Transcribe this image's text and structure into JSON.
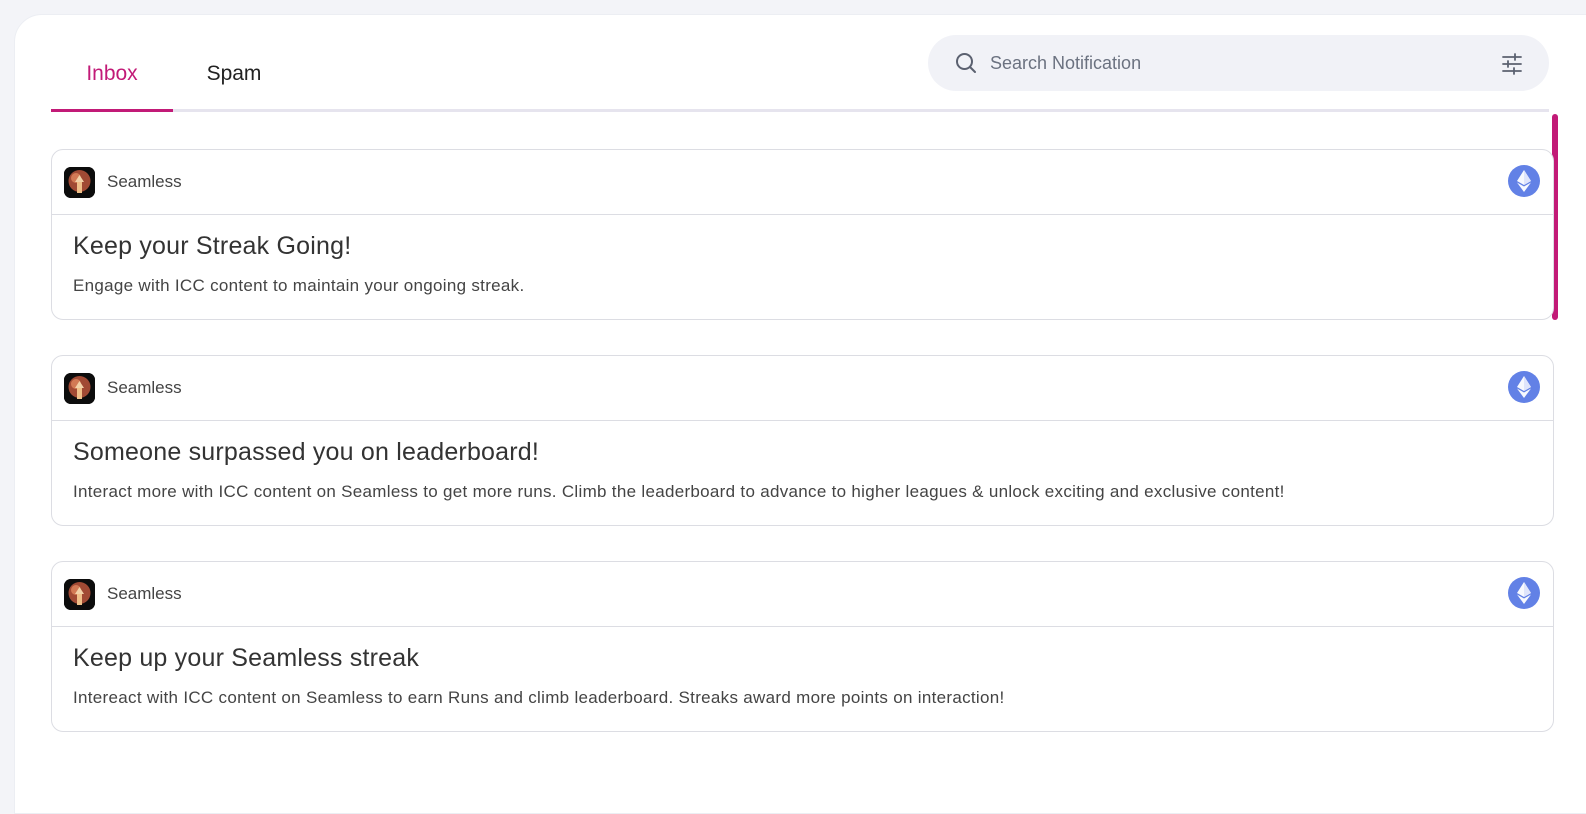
{
  "tabs": [
    {
      "label": "Inbox",
      "active": true
    },
    {
      "label": "Spam",
      "active": false
    }
  ],
  "search": {
    "placeholder": "Search Notification",
    "icon": "search-icon",
    "filter_icon": "filter-sliders-icon"
  },
  "colors": {
    "accent": "#c21a77",
    "chain": "#6281e6"
  },
  "notifications": [
    {
      "source": "Seamless",
      "title": "Keep your Streak Going!",
      "body": "Engage with ICC content to maintain your ongoing streak.",
      "chain_icon": "ethereum-icon"
    },
    {
      "source": "Seamless",
      "title": "Someone surpassed you on leaderboard!",
      "body": "Interact more with ICC content on Seamless to get more runs. Climb the leaderboard to advance to higher leagues & unlock exciting and exclusive content!",
      "chain_icon": "ethereum-icon"
    },
    {
      "source": "Seamless",
      "title": "Keep up your Seamless streak",
      "body": "Intereact with ICC content on Seamless to earn Runs and climb leaderboard. Streaks award more points on interaction!",
      "chain_icon": "ethereum-icon"
    }
  ]
}
